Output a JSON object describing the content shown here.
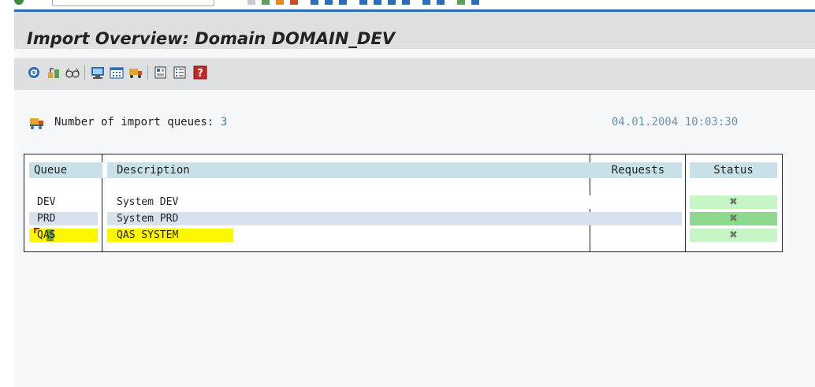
{
  "window": {
    "title": "Import Overview: Domain DOMAIN_DEV"
  },
  "toolbar": {
    "buttons": [
      {
        "name": "refresh-icon"
      },
      {
        "name": "open-queue-icon"
      },
      {
        "name": "glasses-icon"
      },
      {
        "name": "monitor-icon"
      },
      {
        "name": "calendar-icon"
      },
      {
        "name": "lorry-icon"
      },
      {
        "name": "system-icon"
      },
      {
        "name": "list-icon"
      },
      {
        "name": "help-icon"
      }
    ]
  },
  "summary": {
    "label": "Number of import queues:",
    "count": "3",
    "datetime": "04.01.2004 10:03:30"
  },
  "table": {
    "headers": {
      "queue": "Queue",
      "description": "Description",
      "requests": "Requests",
      "status": "Status"
    },
    "rows": [
      {
        "queue": "DEV",
        "description": "System DEV",
        "requests": "",
        "status_icon": "status-x-icon"
      },
      {
        "queue": "PRD",
        "description": "System PRD",
        "requests": "",
        "status_icon": "status-x-icon"
      },
      {
        "queue": "QAS",
        "description": "QAS SYSTEM",
        "requests": "",
        "status_icon": "status-x-icon"
      }
    ]
  },
  "colors": {
    "accent_blue": "#2d6db5",
    "header_bg": "#c8e0e8",
    "row_alt_bg": "#d7e2ee",
    "highlight_yellow": "#fff700",
    "status_green": "#c6f5c6",
    "status_green_dark": "#8fd88f"
  }
}
